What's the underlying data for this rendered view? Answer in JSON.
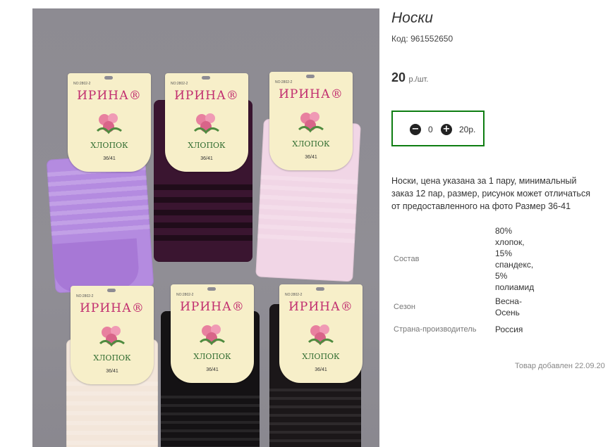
{
  "product": {
    "title": "Носки",
    "code": "Код: 961552650",
    "price_value": "20",
    "price_unit": "р./шт."
  },
  "cart": {
    "minus_icon": "minus-circle-icon",
    "plus_icon": "plus-circle-icon",
    "quantity": "0",
    "sum": "20р."
  },
  "description": [
    "Носки, цена указана за 1 пару, минимальный",
    "заказ 12 пар, размер, рисунок может отличаться",
    "от предоставленного на фото Размер 36-41"
  ],
  "properties": [
    {
      "label": "Состав",
      "value": [
        "80%",
        "хлопок,",
        "15%",
        "спандекс,",
        "5%",
        "полиамид"
      ]
    },
    {
      "label": "Сезон",
      "value": [
        "Весна-",
        "Осень"
      ]
    },
    {
      "label": "Страна-производитель",
      "value": [
        "Россия"
      ]
    }
  ],
  "added": "Товар добавлен 22.09.20",
  "photo": {
    "tags": [
      {
        "no": "NO:2802-2",
        "brand": "ИРИНА®",
        "fiber": "ХЛОПОК",
        "size": "36/41"
      },
      {
        "no": "NO:2802-2",
        "brand": "ИРИНА®",
        "fiber": "ХЛОПОК",
        "size": "36/41"
      },
      {
        "no": "NO:2802-2",
        "brand": "ИРИНА®",
        "fiber": "ХЛОПОК",
        "size": "36/41"
      },
      {
        "no": "NO:2802-2",
        "brand": "ИРИНА®",
        "fiber": "ХЛОПОК",
        "size": "36/41"
      },
      {
        "no": "NO:2802-2",
        "brand": "ИРИНА®",
        "fiber": "ХЛОПОК",
        "size": "36/41"
      },
      {
        "no": "NO:2802-2",
        "brand": "ИРИНА®",
        "fiber": "ХЛОПОК",
        "size": "36/41"
      }
    ],
    "sock_colors": [
      "#b48be0",
      "#3a1530",
      "#f1d6e6",
      "#f3e6da",
      "#141214",
      "#1b1719"
    ],
    "brand_color": "#c12d6f",
    "frame_color": "#0e7d12"
  }
}
